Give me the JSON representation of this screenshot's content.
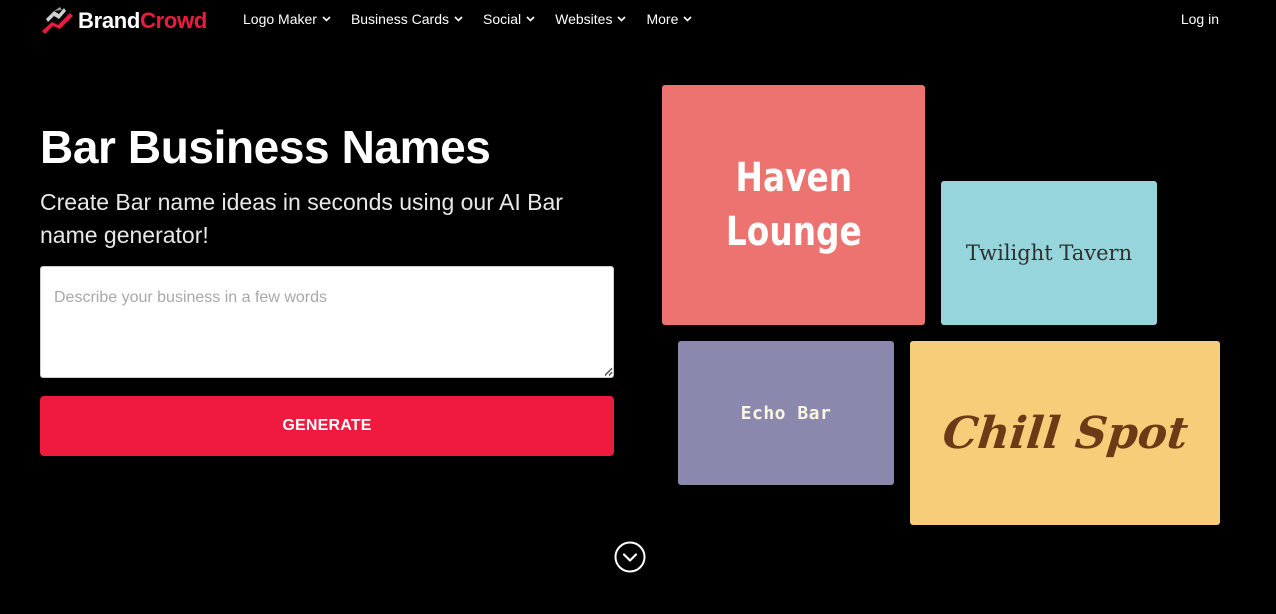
{
  "nav": {
    "logo": {
      "brand": "Brand",
      "crowd": "Crowd"
    },
    "items": [
      {
        "label": "Logo Maker"
      },
      {
        "label": "Business Cards"
      },
      {
        "label": "Social"
      },
      {
        "label": "Websites"
      },
      {
        "label": "More"
      }
    ],
    "login": "Log in"
  },
  "hero": {
    "title": "Bar Business Names",
    "subtitle": "Create Bar name ideas in seconds using our AI Bar name generator!",
    "input": {
      "placeholder": "Describe your business in a few words",
      "value": ""
    },
    "generate_label": "GENERATE"
  },
  "cards": [
    {
      "line1": "Haven",
      "line2": "Lounge",
      "bg": "#ec736f",
      "fg": "#ffffff"
    },
    {
      "text": "Twilight Tavern",
      "bg": "#96d5db",
      "fg": "#2f2f2f"
    },
    {
      "text": "Echo Bar",
      "bg": "#8a89ad",
      "fg": "#fbf4df"
    },
    {
      "text": "Chill Spot",
      "bg": "#f6cd78",
      "fg": "#6b3a16"
    }
  ],
  "colors": {
    "accent": "#f0193e",
    "background": "#000000"
  },
  "icons": {
    "scroll": "chevron-down-circle-icon",
    "logo": "brandcrowd-logo-icon"
  }
}
